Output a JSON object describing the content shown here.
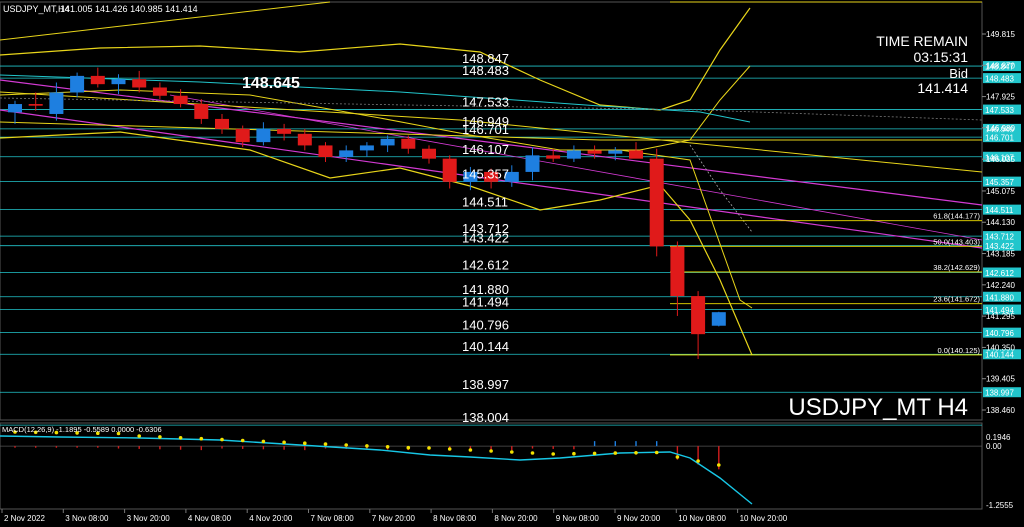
{
  "window": {
    "header": "USDJPY_MT,H4",
    "ohlc": "141.005 141.426 140.985 141.414"
  },
  "info_panel": {
    "time_remain_label": "TIME REMAIN",
    "time_remain_value": "03:15:31",
    "bid_label": "Bid",
    "bid_value": "141.414"
  },
  "symbol_watermark": "USDJPY_MT H4",
  "highlight_level": "148.645",
  "colors": {
    "background": "#000000",
    "bull": "#1e7fe0",
    "bear": "#e01a1a",
    "level_line": "#22c6cc",
    "bollinger": "#e8d51a",
    "trendline": "#d33ad3",
    "fibo": "#f0e000",
    "macd_signal": "#17c7e6",
    "macd_dots": "#f2e100",
    "macd_hist": "#d21d1d"
  },
  "price_axis": {
    "ticks": [
      "149.815",
      "148.870",
      "147.925",
      "146.980",
      "146.035",
      "145.075",
      "144.130",
      "143.185",
      "142.240",
      "141.295",
      "140.350",
      "139.405",
      "138.460"
    ]
  },
  "levels": [
    {
      "value": 148.847,
      "left_label": "148.847",
      "tag": "148.847"
    },
    {
      "value": 148.483,
      "left_label": "148.483",
      "tag": "148.483"
    },
    {
      "value": 147.533,
      "left_label": "147.533",
      "tag": "147.533"
    },
    {
      "value": 146.949,
      "left_label": "146.949",
      "tag": "146.949"
    },
    {
      "value": 146.701,
      "left_label": "146.701",
      "tag": "146.701"
    },
    {
      "value": 146.107,
      "left_label": "146.107",
      "tag": "146.107"
    },
    {
      "value": 145.357,
      "left_label": "145.357",
      "tag": "145.357"
    },
    {
      "value": 144.511,
      "left_label": "144.511",
      "tag": "144.511"
    },
    {
      "value": 143.712,
      "left_label": "143.712",
      "tag": "143.712"
    },
    {
      "value": 143.422,
      "left_label": "143.422",
      "tag": "143.422"
    },
    {
      "value": 142.612,
      "left_label": "142.612",
      "tag": "142.612"
    },
    {
      "value": 141.88,
      "left_label": "141.880",
      "tag": "141.880"
    },
    {
      "value": 141.494,
      "left_label": "141.494",
      "tag": "141.494"
    },
    {
      "value": 140.796,
      "left_label": "140.796",
      "tag": "140.796"
    },
    {
      "value": 140.144,
      "left_label": "140.144",
      "tag": "140.144"
    },
    {
      "value": 138.997,
      "left_label": "138.997",
      "tag": "138.997"
    },
    {
      "value": 138.004,
      "left_label": "138.004",
      "tag": ""
    }
  ],
  "fibo": [
    {
      "value": 144.177,
      "label": "61.8(144.177)"
    },
    {
      "value": 143.403,
      "label": "50.0(143.403)"
    },
    {
      "value": 142.629,
      "label": "38.2(142.629)"
    },
    {
      "value": 141.672,
      "label": "23.6(141.672)"
    },
    {
      "value": 140.125,
      "label": "0.0(140.125)"
    }
  ],
  "macd": {
    "label": "MACD(12,26,9) -1.1895 -0.5589 0.0000 -0.6306",
    "ticks": [
      "0.1946",
      "0.00",
      "-1.2555"
    ]
  },
  "time_axis": {
    "labels": [
      "2 Nov 2022",
      "3 Nov 08:00",
      "3 Nov 20:00",
      "4 Nov 08:00",
      "4 Nov 20:00",
      "7 Nov 08:00",
      "7 Nov 20:00",
      "8 Nov 08:00",
      "8 Nov 20:00",
      "9 Nov 08:00",
      "9 Nov 20:00",
      "10 Nov 08:00",
      "10 Nov 20:00"
    ]
  },
  "chart_data": {
    "type": "candlestick",
    "symbol": "USDJPY_MT",
    "timeframe": "H4",
    "ylim": [
      137.8,
      150.2
    ],
    "candles": [
      {
        "o": 147.45,
        "h": 147.8,
        "l": 147.1,
        "c": 147.7
      },
      {
        "o": 147.7,
        "h": 148.05,
        "l": 147.5,
        "c": 147.65
      },
      {
        "o": 147.4,
        "h": 148.35,
        "l": 147.2,
        "c": 148.05
      },
      {
        "o": 148.05,
        "h": 148.65,
        "l": 147.9,
        "c": 148.55
      },
      {
        "o": 148.55,
        "h": 148.8,
        "l": 148.2,
        "c": 148.3
      },
      {
        "o": 148.3,
        "h": 148.6,
        "l": 148.0,
        "c": 148.45
      },
      {
        "o": 148.45,
        "h": 148.7,
        "l": 148.05,
        "c": 148.2
      },
      {
        "o": 148.2,
        "h": 148.35,
        "l": 147.85,
        "c": 147.95
      },
      {
        "o": 147.95,
        "h": 148.15,
        "l": 147.6,
        "c": 147.7
      },
      {
        "o": 147.7,
        "h": 147.85,
        "l": 147.1,
        "c": 147.25
      },
      {
        "o": 147.25,
        "h": 147.4,
        "l": 146.8,
        "c": 146.95
      },
      {
        "o": 146.95,
        "h": 147.05,
        "l": 146.4,
        "c": 146.55
      },
      {
        "o": 146.55,
        "h": 147.15,
        "l": 146.45,
        "c": 146.95
      },
      {
        "o": 146.95,
        "h": 147.1,
        "l": 146.6,
        "c": 146.8
      },
      {
        "o": 146.8,
        "h": 146.95,
        "l": 146.3,
        "c": 146.45
      },
      {
        "o": 146.45,
        "h": 146.55,
        "l": 145.95,
        "c": 146.1
      },
      {
        "o": 146.1,
        "h": 146.45,
        "l": 145.95,
        "c": 146.3
      },
      {
        "o": 146.3,
        "h": 146.55,
        "l": 146.1,
        "c": 146.45
      },
      {
        "o": 146.45,
        "h": 146.75,
        "l": 146.25,
        "c": 146.65
      },
      {
        "o": 146.65,
        "h": 146.75,
        "l": 146.2,
        "c": 146.35
      },
      {
        "o": 146.35,
        "h": 146.45,
        "l": 145.9,
        "c": 146.05
      },
      {
        "o": 146.05,
        "h": 146.15,
        "l": 145.15,
        "c": 145.35
      },
      {
        "o": 145.35,
        "h": 145.8,
        "l": 145.1,
        "c": 145.65
      },
      {
        "o": 145.65,
        "h": 145.75,
        "l": 145.15,
        "c": 145.35
      },
      {
        "o": 145.35,
        "h": 145.85,
        "l": 145.2,
        "c": 145.65
      },
      {
        "o": 145.65,
        "h": 146.4,
        "l": 145.4,
        "c": 146.15
      },
      {
        "o": 146.15,
        "h": 146.35,
        "l": 145.95,
        "c": 146.05
      },
      {
        "o": 146.05,
        "h": 146.45,
        "l": 145.95,
        "c": 146.3
      },
      {
        "o": 146.3,
        "h": 146.45,
        "l": 146.05,
        "c": 146.2
      },
      {
        "o": 146.2,
        "h": 146.4,
        "l": 146.0,
        "c": 146.3
      },
      {
        "o": 146.3,
        "h": 146.55,
        "l": 146.1,
        "c": 146.05
      },
      {
        "o": 146.05,
        "h": 146.35,
        "l": 143.1,
        "c": 143.4
      },
      {
        "o": 143.4,
        "h": 143.55,
        "l": 141.3,
        "c": 141.9
      },
      {
        "o": 141.9,
        "h": 142.05,
        "l": 140.0,
        "c": 140.75
      },
      {
        "o": 141.005,
        "h": 141.426,
        "l": 140.985,
        "c": 141.414
      }
    ]
  }
}
